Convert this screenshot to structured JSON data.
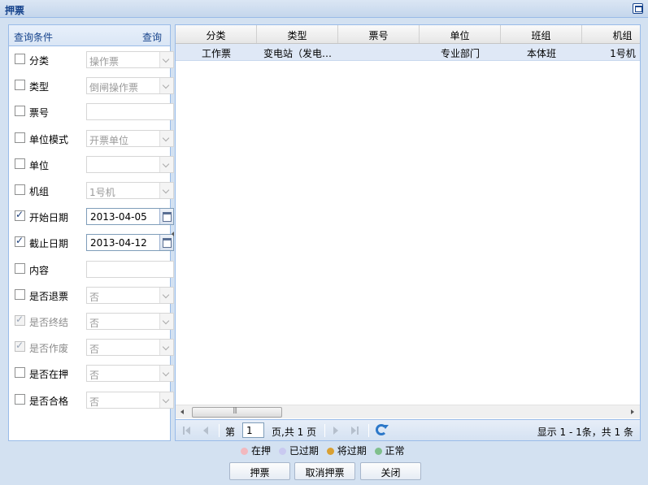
{
  "window": {
    "title": "押票"
  },
  "query": {
    "header_label": "查询条件",
    "search_label": "查询",
    "filters": [
      {
        "label": "分类",
        "checked": false,
        "disabled": false,
        "type": "select",
        "value": "操作票"
      },
      {
        "label": "类型",
        "checked": false,
        "disabled": false,
        "type": "select",
        "value": "倒闸操作票"
      },
      {
        "label": "票号",
        "checked": false,
        "disabled": false,
        "type": "text",
        "value": ""
      },
      {
        "label": "单位模式",
        "checked": false,
        "disabled": false,
        "type": "select",
        "value": "开票单位"
      },
      {
        "label": "单位",
        "checked": false,
        "disabled": false,
        "type": "select",
        "value": ""
      },
      {
        "label": "机组",
        "checked": false,
        "disabled": false,
        "type": "select",
        "value": "1号机"
      },
      {
        "label": "开始日期",
        "checked": true,
        "disabled": false,
        "type": "date",
        "value": "2013-04-05"
      },
      {
        "label": "截止日期",
        "checked": true,
        "disabled": false,
        "type": "date",
        "value": "2013-04-12"
      },
      {
        "label": "内容",
        "checked": false,
        "disabled": false,
        "type": "text",
        "value": ""
      },
      {
        "label": "是否退票",
        "checked": false,
        "disabled": false,
        "type": "select",
        "value": "否"
      },
      {
        "label": "是否终结",
        "checked": true,
        "disabled": true,
        "type": "select",
        "value": "否"
      },
      {
        "label": "是否作废",
        "checked": true,
        "disabled": true,
        "type": "select",
        "value": "否"
      },
      {
        "label": "是否在押",
        "checked": false,
        "disabled": false,
        "type": "select",
        "value": "否"
      },
      {
        "label": "是否合格",
        "checked": false,
        "disabled": false,
        "type": "select",
        "value": "否"
      }
    ]
  },
  "grid": {
    "columns": [
      "分类",
      "类型",
      "票号",
      "单位",
      "班组",
      "机组"
    ],
    "rows": [
      [
        "工作票",
        "变电站（发电…",
        "",
        "专业部门",
        "本体班",
        "1号机"
      ]
    ]
  },
  "pager": {
    "page_prefix": "第",
    "page_value": "1",
    "page_suffix": "页,共 1 页",
    "info": "显示 1 - 1条，共 1 条"
  },
  "legend": [
    {
      "label": "在押",
      "color": "#f2b8be"
    },
    {
      "label": "已过期",
      "color": "#c9c9f0"
    },
    {
      "label": "将过期",
      "color": "#d9a032"
    },
    {
      "label": "正常",
      "color": "#7fbf8c"
    }
  ],
  "buttons": {
    "pawn": "押票",
    "cancel_pawn": "取消押票",
    "close": "关闭"
  }
}
